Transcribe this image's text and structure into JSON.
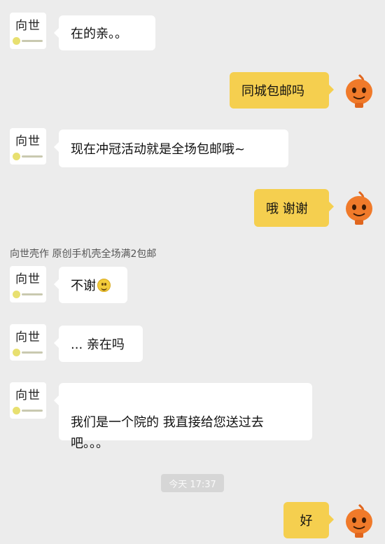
{
  "shop": {
    "avatar_text": "向世",
    "name_line": "向世壳作  原创手机壳全场满2包邮"
  },
  "messages": [
    {
      "id": "m1",
      "side": "left",
      "text": "在的亲。。"
    },
    {
      "id": "m2",
      "side": "right",
      "text": "同城包邮吗"
    },
    {
      "id": "m3",
      "side": "left",
      "text": "现在冲冠活动就是全场包邮哦~"
    },
    {
      "id": "m4",
      "side": "right",
      "text": "哦 谢谢"
    },
    {
      "id": "m5",
      "side": "left",
      "text": "不谢",
      "emoji": "smile-emoji"
    },
    {
      "id": "m6",
      "side": "left",
      "text": "... 亲在吗"
    },
    {
      "id": "m7",
      "side": "left",
      "text": "我们是一个院的  我直接给您送过去\n吧。。。"
    },
    {
      "id": "m8",
      "side": "right",
      "text": "好"
    }
  ],
  "timestamp": "今天 17:37",
  "colors": {
    "background": "#ececec",
    "bubble_left": "#ffffff",
    "bubble_right": "#f5cf4f",
    "user_avatar": "#f07a2a"
  },
  "icons": {
    "user_avatar": "orange-cartoon-avatar-icon",
    "shop_avatar": "xiangshi-logo-icon"
  }
}
